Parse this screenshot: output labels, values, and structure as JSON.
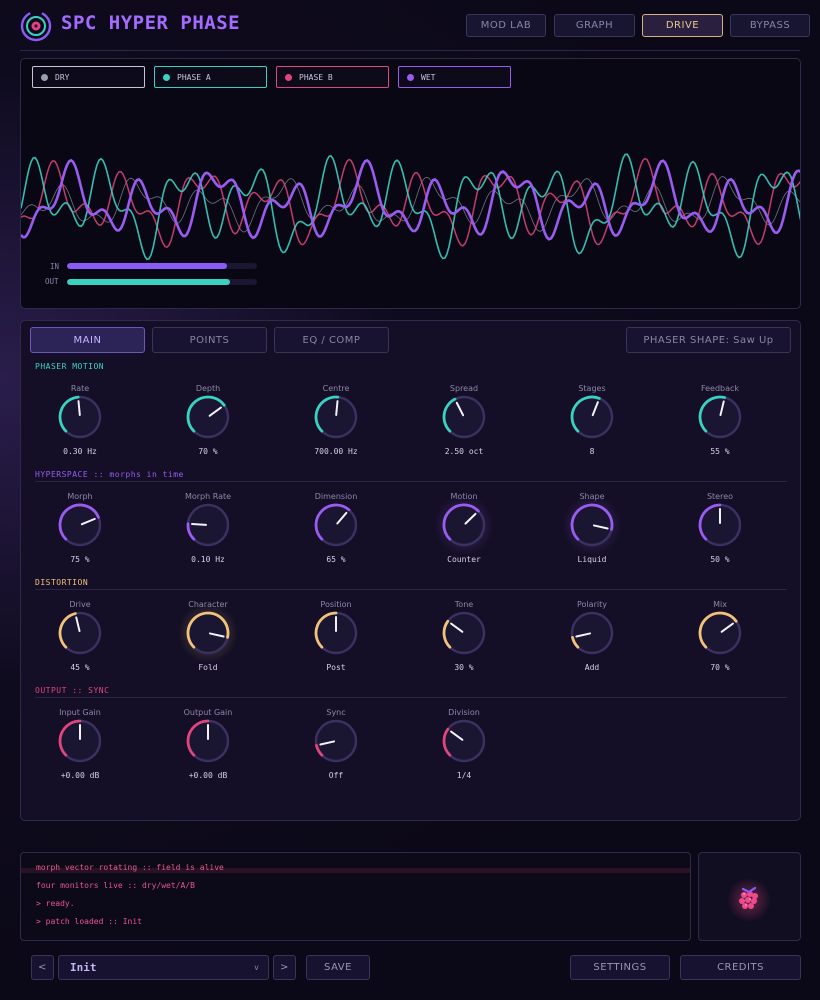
{
  "app": {
    "title": "SPC HYPER PHASE"
  },
  "header": {
    "buttons": [
      {
        "label": "MOD LAB",
        "active": false
      },
      {
        "label": "GRAPH",
        "active": false
      },
      {
        "label": "DRIVE",
        "active": true
      },
      {
        "label": "BYPASS",
        "active": false
      }
    ]
  },
  "scope": {
    "legend": [
      {
        "label": "DRY",
        "color": "#9aa0b0"
      },
      {
        "label": "PHASE A",
        "color": "#39d2c0"
      },
      {
        "label": "PHASE B",
        "color": "#e0457b"
      },
      {
        "label": "WET",
        "color": "#9a5cf0"
      }
    ],
    "meters": [
      {
        "label": "IN",
        "level": 0.84,
        "color": "#8a5cf5"
      },
      {
        "label": "OUT",
        "level": 0.86,
        "color": "#39d2c0"
      }
    ]
  },
  "tabs": [
    {
      "label": "MAIN",
      "active": true
    },
    {
      "label": "POINTS",
      "active": false
    },
    {
      "label": "EQ / COMP",
      "active": false
    }
  ],
  "shape_button": {
    "label": "PHASER SHAPE: Saw Up"
  },
  "sections": [
    {
      "title": "PHASER MOTION",
      "color": "#39d2c0",
      "knobs": [
        {
          "label": "Rate",
          "value": "0.30 Hz",
          "level": 0.48
        },
        {
          "label": "Depth",
          "value": "70 %",
          "level": 0.7
        },
        {
          "label": "Centre",
          "value": "700.00 Hz",
          "level": 0.52
        },
        {
          "label": "Spread",
          "value": "2.50 oct",
          "level": 0.4
        },
        {
          "label": "Stages",
          "value": "8",
          "level": 0.58
        },
        {
          "label": "Feedback",
          "value": "55 %",
          "level": 0.55
        }
      ]
    },
    {
      "title": "HYPERSPACE  ::  morphs in time",
      "color": "#9a5cf0",
      "knobs": [
        {
          "label": "Morph",
          "value": "75 %",
          "level": 0.75
        },
        {
          "label": "Morph Rate",
          "value": "0.10 Hz",
          "level": 0.18
        },
        {
          "label": "Dimension",
          "value": "65 %",
          "level": 0.65
        },
        {
          "label": "Motion",
          "value": "Counter",
          "level": 0.67
        },
        {
          "label": "Shape",
          "value": "Liquid",
          "level": 0.88
        },
        {
          "label": "Stereo",
          "value": "50 %",
          "level": 0.5
        }
      ]
    },
    {
      "title": "DISTORTION",
      "color": "#f2c27a",
      "knobs": [
        {
          "label": "Drive",
          "value": "45 %",
          "level": 0.45
        },
        {
          "label": "Character",
          "value": "Fold",
          "level": 0.88
        },
        {
          "label": "Position",
          "value": "Post",
          "level": 0.5
        },
        {
          "label": "Tone",
          "value": "30 %",
          "level": 0.3
        },
        {
          "label": "Polarity",
          "value": "Add",
          "level": 0.12
        },
        {
          "label": "Mix",
          "value": "70 %",
          "level": 0.7
        }
      ]
    },
    {
      "title": "OUTPUT  ::  SYNC",
      "color": "#e0457b",
      "knobs": [
        {
          "label": "Input Gain",
          "value": "+0.00 dB",
          "level": 0.5
        },
        {
          "label": "Output Gain",
          "value": "+0.00 dB",
          "level": 0.5
        },
        {
          "label": "Sync",
          "value": "Off",
          "level": 0.12
        },
        {
          "label": "Division",
          "value": "1/4",
          "level": 0.3
        }
      ]
    }
  ],
  "console": {
    "lines": [
      "morph vector rotating :: field is alive",
      "four monitors live :: dry/wet/A/B",
      "> ready.",
      "> patch loaded :: Init"
    ]
  },
  "footer": {
    "prev": "<",
    "next": ">",
    "preset": "Init",
    "save": "SAVE",
    "settings": "SETTINGS",
    "credits": "CREDITS"
  },
  "colors": {
    "accent": "#a36bff",
    "teal": "#39d2c0",
    "pink": "#e0457b",
    "gold": "#f2c27a"
  }
}
